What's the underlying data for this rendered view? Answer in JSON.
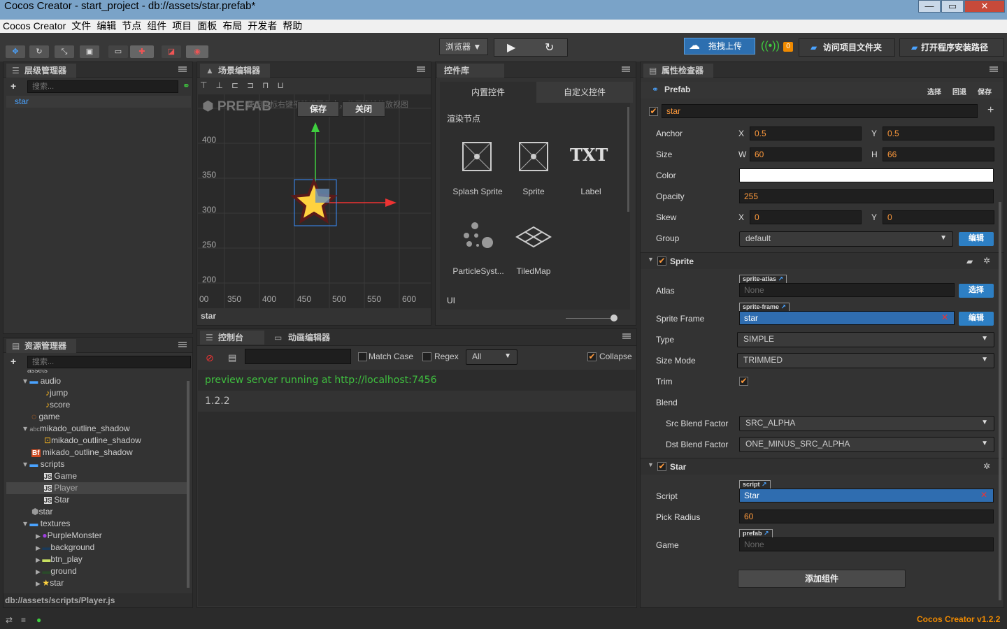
{
  "window": {
    "title": "Cocos Creator - start_project - db://assets/star.prefab*"
  },
  "menu": [
    "Cocos Creator",
    "文件",
    "编辑",
    "节点",
    "组件",
    "项目",
    "面板",
    "布局",
    "开发者",
    "帮助"
  ],
  "toolbar": {
    "browser_label": "浏览器",
    "upload_label": "拖拽上传",
    "notify_count": "0",
    "open_project_label": "访问项目文件夹",
    "open_install_label": "打开程序安装路径"
  },
  "hierarchy": {
    "title": "层级管理器",
    "search_placeholder": "搜索...",
    "items": [
      "star"
    ]
  },
  "scene": {
    "title": "场景编辑器",
    "prefab_label": "PREFAB",
    "save_label": "保存",
    "close_label": "关闭",
    "hint": "使用鼠标右键平移视图焦点，使用滚轮缩放视图",
    "y_ticks": [
      "400",
      "350",
      "300",
      "250",
      "200"
    ],
    "x_ticks": [
      "00",
      "350",
      "400",
      "450",
      "500",
      "550",
      "600"
    ],
    "footer": "star"
  },
  "widgets": {
    "title": "控件库",
    "tab_builtin": "内置控件",
    "tab_custom": "自定义控件",
    "section_render": "渲染节点",
    "items": [
      "Splash Sprite",
      "Sprite",
      "Label",
      "ParticleSyst...",
      "TiledMap"
    ],
    "txt_icon": "TXT",
    "section_ui": "UI"
  },
  "assets": {
    "title": "资源管理器",
    "search_placeholder": "搜索...",
    "root": "assets",
    "items": [
      "audio",
      "jump",
      "score",
      "game",
      "mikado_outline_shadow",
      "mikado_outline_shadow",
      "mikado_outline_shadow",
      "scripts",
      "Game",
      "Player",
      "Star",
      "star",
      "textures",
      "PurpleMonster",
      "background",
      "btn_play",
      "ground",
      "star"
    ],
    "status": "db://assets/scripts/Player.js"
  },
  "console": {
    "tab_console": "控制台",
    "tab_animation": "动画编辑器",
    "match_case": "Match Case",
    "regex": "Regex",
    "filter": "All",
    "collapse": "Collapse",
    "lines": [
      "preview server running at http://localhost:7456",
      "1.2.2"
    ]
  },
  "inspector": {
    "title": "属性检查器",
    "prefab_label": "Prefab",
    "prefab_actions": [
      "选择",
      "回退",
      "保存"
    ],
    "node_name": "star",
    "anchor": {
      "label": "Anchor",
      "x": "0.5",
      "y": "0.5"
    },
    "size": {
      "label": "Size",
      "w": "60",
      "h": "66"
    },
    "color_label": "Color",
    "opacity": {
      "label": "Opacity",
      "value": "255"
    },
    "skew": {
      "label": "Skew",
      "x": "0",
      "y": "0"
    },
    "group": {
      "label": "Group",
      "value": "default",
      "edit": "编辑"
    },
    "axis": {
      "x": "X",
      "y": "Y",
      "w": "W",
      "h": "H"
    },
    "sprite": {
      "title": "Sprite",
      "atlas_label": "Atlas",
      "atlas_tag": "sprite-atlas",
      "atlas_value": "None",
      "atlas_btn": "选择",
      "frame_label": "Sprite Frame",
      "frame_tag": "sprite-frame",
      "frame_value": "star",
      "frame_btn": "编辑",
      "type_label": "Type",
      "type_value": "SIMPLE",
      "sizemode_label": "Size Mode",
      "sizemode_value": "TRIMMED",
      "trim_label": "Trim",
      "blend_label": "Blend",
      "src_label": "Src Blend Factor",
      "src_value": "SRC_ALPHA",
      "dst_label": "Dst Blend Factor",
      "dst_value": "ONE_MINUS_SRC_ALPHA"
    },
    "star": {
      "title": "Star",
      "script_label": "Script",
      "script_tag": "script",
      "script_value": "Star",
      "pick_label": "Pick Radius",
      "pick_value": "60",
      "game_label": "Game",
      "game_tag": "prefab",
      "game_value": "None"
    },
    "add_component": "添加组件"
  },
  "statusbar": {
    "version": "Cocos Creator v1.2.2"
  }
}
